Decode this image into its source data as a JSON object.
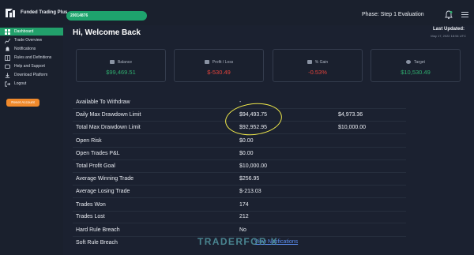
{
  "app": {
    "name": "Funded Trading Plus"
  },
  "header": {
    "account_id": "20014876",
    "phase": "Phase: Step 1 Evaluation",
    "bell_icon": "bell-icon",
    "menu_icon": "hamburger-icon"
  },
  "sidebar": {
    "items": [
      {
        "label": "Dashboard",
        "icon": "dashboard-icon",
        "active": true
      },
      {
        "label": "Trade Overview",
        "icon": "chart-icon"
      },
      {
        "label": "Notifications",
        "icon": "bell-icon"
      },
      {
        "label": "Rules and Definitions",
        "icon": "book-icon"
      },
      {
        "label": "Help and Support",
        "icon": "help-icon"
      },
      {
        "label": "Download Platform",
        "icon": "download-icon"
      },
      {
        "label": "Logout",
        "icon": "logout-icon"
      }
    ],
    "reset_button": "Reset Account"
  },
  "main": {
    "welcome": "Hi, Welcome Back",
    "last_updated_label": "Last Updated:",
    "last_updated_value": "May 17, 2022 18:54 UTC",
    "cards": [
      {
        "label": "Balance",
        "value": "$99,469.51",
        "tone": "green"
      },
      {
        "label": "Profit / Loss",
        "value": "$-530.49",
        "tone": "red"
      },
      {
        "label": "% Gain",
        "value": "-0.53%",
        "tone": "red"
      },
      {
        "label": "Target",
        "value": "$10,530.49",
        "tone": "green"
      }
    ],
    "rows": [
      {
        "label": "Available To Withdraw",
        "value": "-",
        "value2": ""
      },
      {
        "label": "Daily Max Drawdown Limit",
        "value": "$94,493.75",
        "value2": "$4,973.36"
      },
      {
        "label": "Total Max Drawdown Limit",
        "value": "$92,952.95",
        "value2": "$10,000.00"
      },
      {
        "label": "Open Risk",
        "value": "$0.00",
        "value2": ""
      },
      {
        "label": "Open Trades P&L",
        "value": "$0.00",
        "value2": ""
      },
      {
        "label": "Total Profit Goal",
        "value": "$10,000.00",
        "value2": ""
      },
      {
        "label": "Average Winning Trade",
        "value": "$256.95",
        "value2": ""
      },
      {
        "label": "Average Losing Trade",
        "value": "$-213.03",
        "value2": "",
        "tone": "red"
      },
      {
        "label": "Trades Won",
        "value": "174",
        "value2": ""
      },
      {
        "label": "Trades Lost",
        "value": "212",
        "value2": ""
      },
      {
        "label": "Hard Rule Breach",
        "value": "No",
        "value2": ""
      },
      {
        "label": "Soft Rule Breach",
        "value": "",
        "value2": ""
      }
    ],
    "violations_link": "View Notifications"
  },
  "watermark": "TRADERFOR X",
  "colors": {
    "accent": "#22a06b",
    "danger": "#e2433b",
    "warning": "#f08a2c",
    "bg": "#1b2130"
  }
}
